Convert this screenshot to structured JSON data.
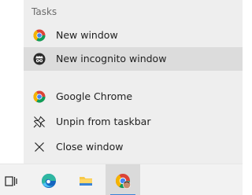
{
  "jump_list": {
    "section_header": "Tasks",
    "items": [
      {
        "label": "New window",
        "icon": "chrome-icon"
      },
      {
        "label": "New incognito window",
        "icon": "incognito-icon"
      },
      {
        "label": "Google Chrome",
        "icon": "chrome-icon"
      },
      {
        "label": "Unpin from taskbar",
        "icon": "unpin-icon"
      },
      {
        "label": "Close window",
        "icon": "close-icon"
      }
    ]
  },
  "taskbar": {
    "buttons": [
      {
        "name": "task-view",
        "icon": "task-view-icon"
      },
      {
        "name": "edge",
        "icon": "edge-icon"
      },
      {
        "name": "file-explorer",
        "icon": "folder-icon"
      },
      {
        "name": "chrome",
        "icon": "chrome-with-avatar-icon",
        "active": true
      }
    ]
  },
  "colors": {
    "menu_bg": "#eeeeee",
    "hover_bg": "#dcdcdc",
    "taskbar_bg": "#f2f2f2",
    "accent": "#3b83d6",
    "text": "#1f1f1f",
    "muted": "#6b6b6b"
  }
}
